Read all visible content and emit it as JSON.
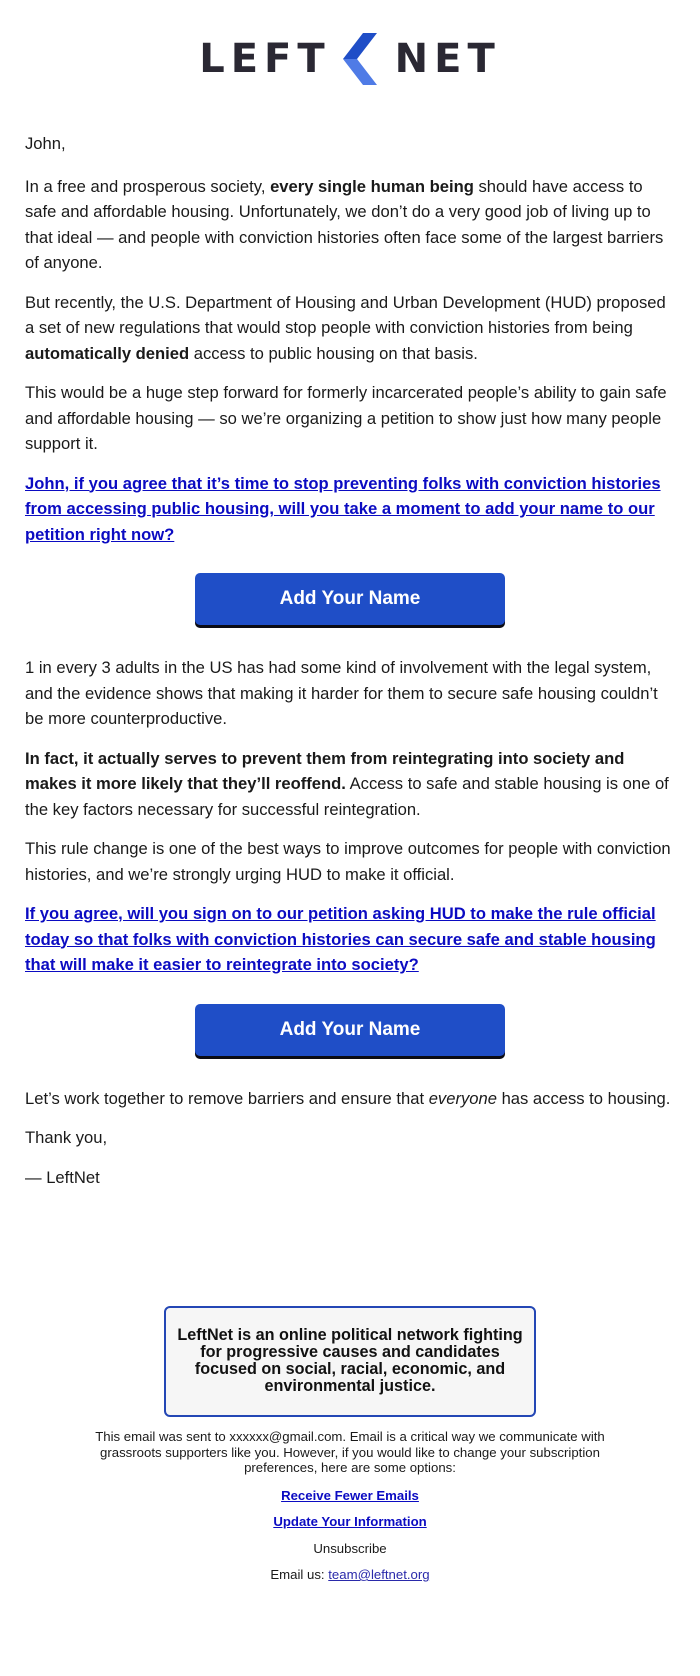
{
  "brand": {
    "left_word": "LEFT",
    "right_word": "NET",
    "logo_icon": "chevron-left-icon",
    "colors": {
      "wordmark": "#2a2833",
      "chevron_top": "#1f4ec7",
      "chevron_bottom": "#4f7be6",
      "button": "#1f4ec7",
      "link": "#0b0bc2",
      "box_border": "#2447b5",
      "box_bg": "#f6f6f6"
    }
  },
  "email": {
    "greeting": "John,",
    "p1": {
      "before": "In a free and prosperous society, ",
      "bold": "every single human being",
      "after": " should have access to safe and affordable housing. Unfortunately, we don’t do a very good job of living up to that ideal — and people with conviction histories often face some of the largest barriers of anyone."
    },
    "p2": {
      "before": "But recently, the U.S. Department of Housing and Urban Development (HUD) proposed a set of new regulations that would stop people with conviction histories from being ",
      "bold": "automatically denied",
      "after": " access to public housing on that basis."
    },
    "p3": "This would be a huge step forward for formerly incarcerated people’s ability to gain safe and affordable housing — so we’re organizing a petition to show just how many people support it.",
    "cta_link_1": "John, if you agree that it’s time to stop preventing folks with conviction histories from accessing public housing, will you take a moment to add your name to our petition right now?",
    "button_1": "Add Your Name",
    "p4": "1 in every 3 adults in the US has had some kind of involvement with the legal system, and the evidence shows that making it harder for them to secure safe housing couldn’t be more counterproductive.",
    "p5": {
      "bold": "In fact, it actually serves to prevent them from reintegrating into society and makes it more likely that they’ll reoffend.",
      "after": " Access to safe and stable housing is one of the key factors necessary for successful reintegration."
    },
    "p6": "This rule change is one of the best ways to improve outcomes for people with conviction histories, and we’re strongly urging HUD to make it official.",
    "cta_link_2": "If you agree, will you sign on to our petition asking HUD to make the rule official today so that folks with conviction histories can secure safe and stable housing that will make it easier to reintegrate into society?",
    "button_2": "Add Your Name",
    "p7": {
      "before": "Let’s work together to remove barriers and ensure that ",
      "italic": "everyone",
      "after": " has access to housing."
    },
    "signoff": "Thank you,",
    "signature": "— LeftNet"
  },
  "footer": {
    "about": "LeftNet is an online political network fighting for progressive causes and candidates focused on social, racial, economic, and environmental justice.",
    "sent_notice": "This email was sent to xxxxxx@gmail.com. Email is a critical way we communicate with grassroots supporters like you. However, if you would like to change your subscription preferences, here are some options:",
    "receive_fewer": "Receive Fewer Emails",
    "update_info": "Update Your Information",
    "unsubscribe": "Unsubscribe",
    "email_us_label": "Email us: ",
    "email_address": "team@leftnet.org"
  }
}
